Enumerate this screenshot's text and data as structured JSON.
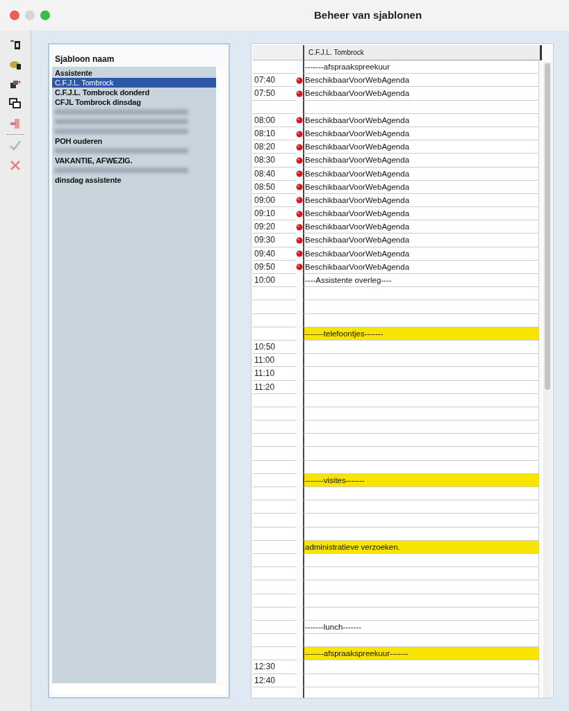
{
  "window": {
    "title": "Beheer van sjablonen"
  },
  "toolbar": [
    {
      "kind": "new"
    },
    {
      "kind": "edit"
    },
    {
      "kind": "copy"
    },
    {
      "kind": "duplicate"
    },
    {
      "kind": "delete"
    },
    {
      "kind": "separator"
    },
    {
      "kind": "accept"
    },
    {
      "kind": "cancel"
    }
  ],
  "template_list": {
    "header": "Sjabloon naam",
    "items": [
      {
        "kind": "text",
        "label": "Assistente",
        "selected": false
      },
      {
        "kind": "text",
        "label": "C.F.J.L. Tombrock",
        "selected": true
      },
      {
        "kind": "text",
        "label": "C.F.J.L. Tombrock donderd",
        "selected": false
      },
      {
        "kind": "text",
        "label": "CFJL Tombrock dinsdag",
        "selected": false
      },
      {
        "kind": "redacted",
        "selected": false
      },
      {
        "kind": "redacted",
        "selected": false
      },
      {
        "kind": "redacted",
        "selected": false
      },
      {
        "kind": "text",
        "label": "POH ouderen",
        "selected": false
      },
      {
        "kind": "redacted",
        "selected": false
      },
      {
        "kind": "text",
        "label": "VAKANTIE, AFWEZIG.",
        "selected": false
      },
      {
        "kind": "redacted",
        "selected": false
      },
      {
        "kind": "text",
        "label": "dinsdag assistente",
        "selected": false
      }
    ]
  },
  "schedule": {
    "column_header": "C.F.J.L. Tombrock",
    "rows": [
      {
        "entry": "-------afspraakspreekuur",
        "marked": false,
        "highlighted": false
      },
      {
        "time": "07:40",
        "entry": "BeschikbaarVoorWebAgenda",
        "marked": true,
        "highlighted": false
      },
      {
        "time": "07:50",
        "entry": "BeschikbaarVoorWebAgenda",
        "marked": true,
        "highlighted": false
      },
      {
        "marked": false,
        "highlighted": false
      },
      {
        "time": "08:00",
        "entry": "BeschikbaarVoorWebAgenda",
        "marked": true,
        "highlighted": false
      },
      {
        "time": "08:10",
        "entry": "BeschikbaarVoorWebAgenda",
        "marked": true,
        "highlighted": false
      },
      {
        "time": "08:20",
        "entry": "BeschikbaarVoorWebAgenda",
        "marked": true,
        "highlighted": false
      },
      {
        "time": "08:30",
        "entry": "BeschikbaarVoorWebAgenda",
        "marked": true,
        "highlighted": false
      },
      {
        "time": "08:40",
        "entry": "BeschikbaarVoorWebAgenda",
        "marked": true,
        "highlighted": false
      },
      {
        "time": "08:50",
        "entry": "BeschikbaarVoorWebAgenda",
        "marked": true,
        "highlighted": false
      },
      {
        "time": "09:00",
        "entry": "BeschikbaarVoorWebAgenda",
        "marked": true,
        "highlighted": false
      },
      {
        "time": "09:10",
        "entry": "BeschikbaarVoorWebAgenda",
        "marked": true,
        "highlighted": false
      },
      {
        "time": "09:20",
        "entry": "BeschikbaarVoorWebAgenda",
        "marked": true,
        "highlighted": false
      },
      {
        "time": "09:30",
        "entry": "BeschikbaarVoorWebAgenda",
        "marked": true,
        "highlighted": false
      },
      {
        "time": "09:40",
        "entry": "BeschikbaarVoorWebAgenda",
        "marked": true,
        "highlighted": false
      },
      {
        "time": "09:50",
        "entry": "BeschikbaarVoorWebAgenda",
        "marked": true,
        "highlighted": false
      },
      {
        "time": "10:00",
        "entry": "----Assistente overleg----",
        "marked": false,
        "highlighted": false
      },
      {
        "marked": false,
        "highlighted": false
      },
      {
        "marked": false,
        "highlighted": false
      },
      {
        "marked": false,
        "highlighted": false
      },
      {
        "entry": "-------telefoontjes-------",
        "marked": false,
        "highlighted": true
      },
      {
        "time": "10:50",
        "marked": false,
        "highlighted": false
      },
      {
        "time": "11:00",
        "marked": false,
        "highlighted": false
      },
      {
        "time": "11:10",
        "marked": false,
        "highlighted": false
      },
      {
        "time": "11:20",
        "marked": false,
        "highlighted": false
      },
      {
        "marked": false,
        "highlighted": false
      },
      {
        "marked": false,
        "highlighted": false
      },
      {
        "marked": false,
        "highlighted": false
      },
      {
        "marked": false,
        "highlighted": false
      },
      {
        "marked": false,
        "highlighted": false
      },
      {
        "marked": false,
        "highlighted": false
      },
      {
        "entry": "-------visites-------",
        "marked": false,
        "highlighted": true
      },
      {
        "marked": false,
        "highlighted": false
      },
      {
        "marked": false,
        "highlighted": false
      },
      {
        "marked": false,
        "highlighted": false
      },
      {
        "marked": false,
        "highlighted": false
      },
      {
        "entry": "administratieve verzoeken.",
        "marked": false,
        "highlighted": true
      },
      {
        "marked": false,
        "highlighted": false
      },
      {
        "marked": false,
        "highlighted": false
      },
      {
        "marked": false,
        "highlighted": false
      },
      {
        "marked": false,
        "highlighted": false
      },
      {
        "marked": false,
        "highlighted": false
      },
      {
        "entry": "-------lunch-------",
        "marked": false,
        "highlighted": false
      },
      {
        "marked": false,
        "highlighted": false
      },
      {
        "entry": "-------afspraakspreekuur-------",
        "marked": false,
        "highlighted": true
      },
      {
        "time": "12:30",
        "marked": false,
        "highlighted": false
      },
      {
        "time": "12:40",
        "marked": false,
        "highlighted": false
      },
      {
        "marked": false,
        "highlighted": false
      }
    ]
  }
}
